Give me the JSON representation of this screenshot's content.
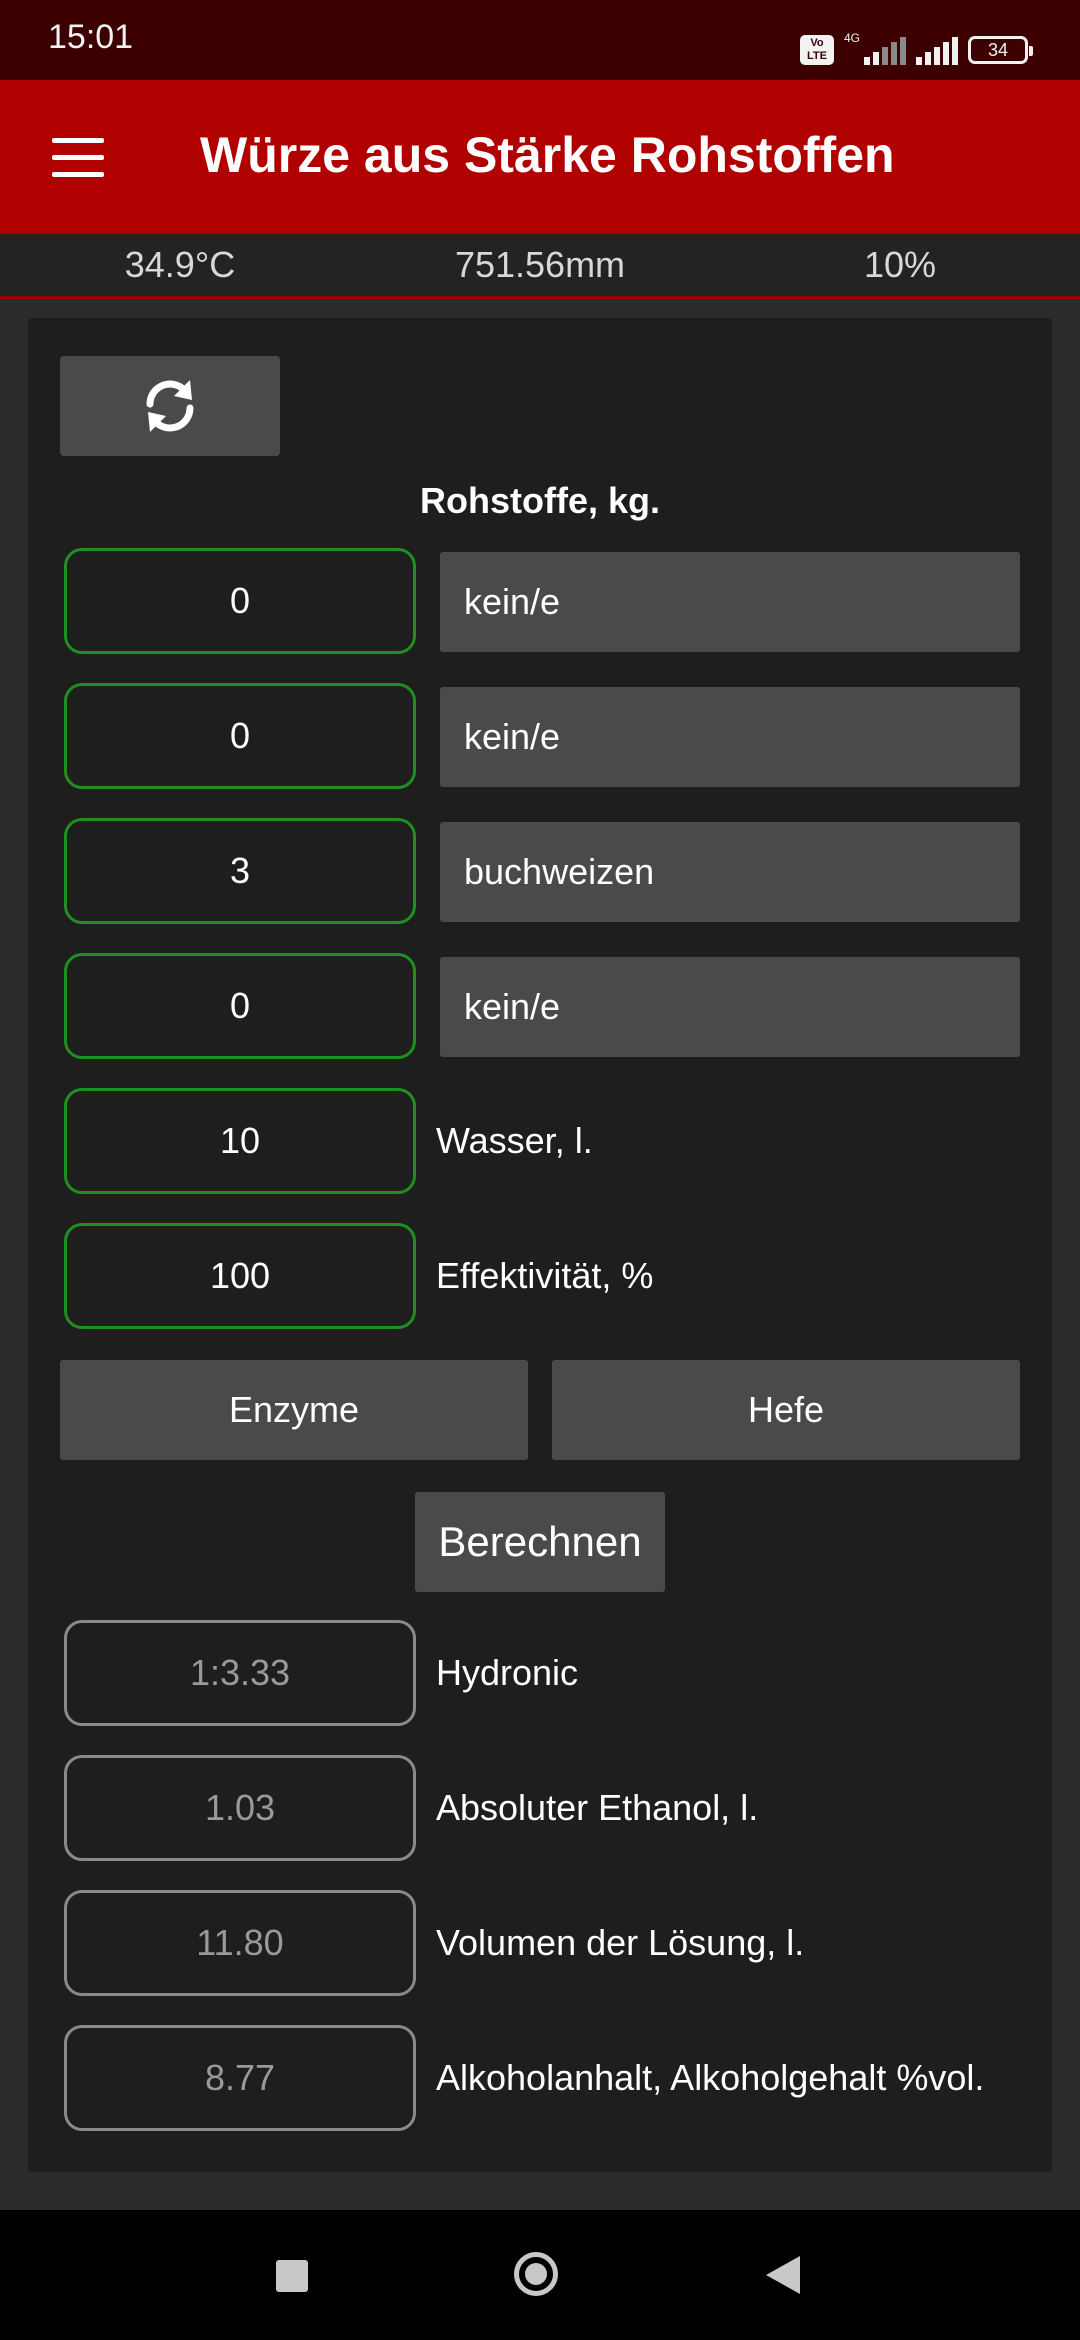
{
  "status_bar": {
    "time": "15:01",
    "network": "4G",
    "volte": "Vo LTE",
    "battery": "34"
  },
  "app_bar": {
    "title": "Würze aus Stärke Rohstoffen"
  },
  "sensors": {
    "temperature": "34.9°C",
    "pressure": "751.56mm",
    "humidity": "10%"
  },
  "form": {
    "section_title": "Rohstoffe, kg.",
    "raw_materials": [
      {
        "amount": "0",
        "type": "kein/e"
      },
      {
        "amount": "0",
        "type": "kein/e"
      },
      {
        "amount": "3",
        "type": "buchweizen"
      },
      {
        "amount": "0",
        "type": "kein/e"
      }
    ],
    "water": {
      "value": "10",
      "label": "Wasser, l."
    },
    "efficiency": {
      "value": "100",
      "label": "Effektivität, %"
    },
    "enzyme_button": "Enzyme",
    "yeast_button": "Hefe",
    "calculate_button": "Berechnen"
  },
  "results": [
    {
      "value": "1:3.33",
      "label": "Hydronic"
    },
    {
      "value": "1.03",
      "label": "Absoluter Ethanol, l."
    },
    {
      "value": "11.80",
      "label": "Volumen der Lösung, l."
    },
    {
      "value": "8.77",
      "label": "Alkoholanhalt, Alkoholgehalt %vol."
    }
  ],
  "colors": {
    "app_bar": "#b00000",
    "status_bar": "#3d0000",
    "input_border": "#1f8f1f",
    "output_border": "#8a8a8a"
  }
}
